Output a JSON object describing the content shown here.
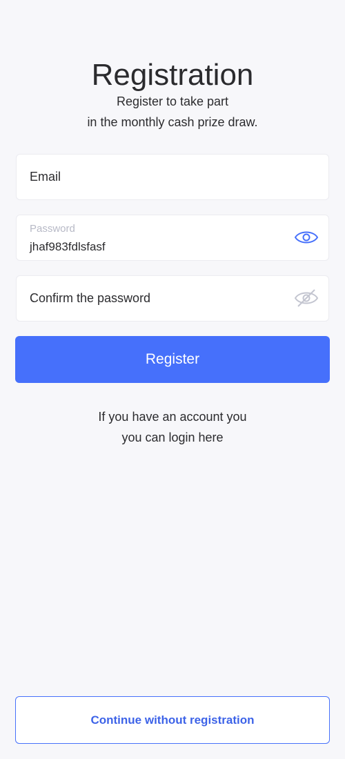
{
  "page": {
    "title": "Registration",
    "subtitle_line1": "Register to take part",
    "subtitle_line2": "in the monthly cash prize draw."
  },
  "form": {
    "email": {
      "placeholder": "Email"
    },
    "password": {
      "label": "Password",
      "value": "jhaf983fdlsfasf",
      "icon": "eye-icon"
    },
    "confirm_password": {
      "placeholder": "Confirm the password",
      "icon": "eye-off-icon"
    },
    "register_label": "Register"
  },
  "login": {
    "line1": "If you have an account you",
    "line2": "you can login here"
  },
  "continue_label": "Continue without registration",
  "colors": {
    "accent": "#4670fb",
    "background": "#f7f7fa",
    "text": "#2b2b2e",
    "muted": "#b7b9c6"
  }
}
